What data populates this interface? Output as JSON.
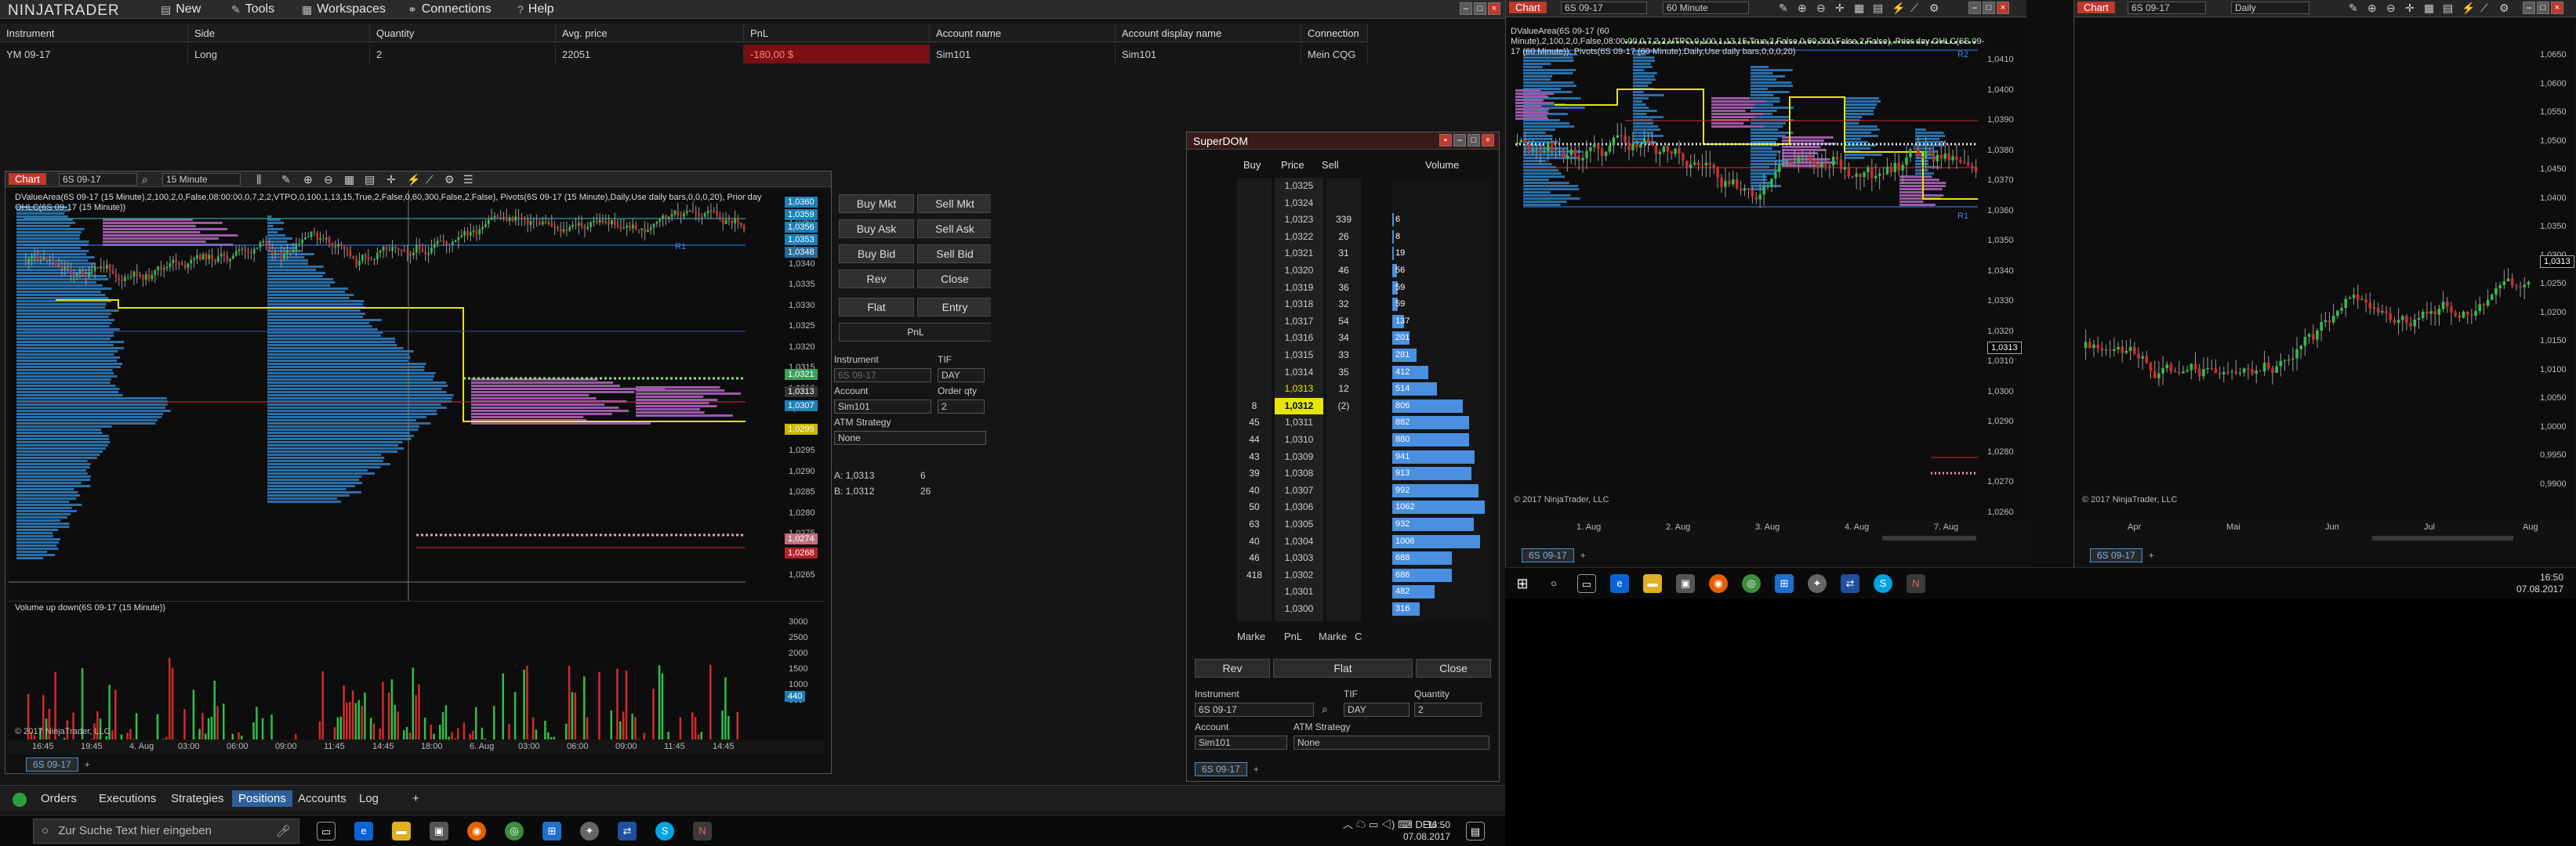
{
  "app": {
    "logo": "NINJATRADER"
  },
  "menu": [
    {
      "label": "New",
      "icon": "new-icon"
    },
    {
      "label": "Tools",
      "icon": "tools-icon"
    },
    {
      "label": "Workspaces",
      "icon": "workspaces-icon"
    },
    {
      "label": "Connections",
      "icon": "connections-icon"
    },
    {
      "label": "Help",
      "icon": "help-icon"
    }
  ],
  "positions": {
    "headers": [
      "Instrument",
      "Side",
      "Quantity",
      "Avg. price",
      "PnL",
      "Account name",
      "Account display name",
      "Connection"
    ],
    "row": [
      "YM 09-17",
      "Long",
      "2",
      "22051",
      "-180,00 $",
      "Sim101",
      "Sim101",
      "Mein CQG"
    ]
  },
  "chart1": {
    "title": "Chart",
    "instrument": "6S 09-17",
    "interval": "15 Minute",
    "description": "DValueArea(6S 09-17 (15 Minute),2,100,2,0,False,08:00:00,0,7,2,2,VTPO,0,100,1,13,15,True,2,False,0,60,300,False,2,False), Pivots(6S 09-17 (15 Minute),Daily,Use daily bars,0,0,0,20), Prior day OHLC(6S 09-17 (15 Minute))",
    "copyright": "© 2017 NinjaTrader, LLC",
    "subpanel": "Volume up down(6S 09-17 (15 Minute))",
    "pivot_label": "R1",
    "price_axis": [
      "1,0355",
      "1,0350",
      "1,0345",
      "1,0340",
      "1,0335",
      "1,0330",
      "1,0325",
      "1,0320",
      "1,0315",
      "1,0310",
      "1,0305",
      "1,0300",
      "1,0295",
      "1,0290",
      "1,0285",
      "1,0280",
      "1,0275",
      "1,0270",
      "1,0265"
    ],
    "vol_axis": [
      "3000",
      "2500",
      "2000",
      "1500",
      "1000",
      "500"
    ],
    "vol_tag": "440",
    "time_axis": [
      "16:45",
      "19:45",
      "4. Aug",
      "03:00",
      "06:00",
      "09:00",
      "11:45",
      "14:45",
      "18:00",
      "6. Aug",
      "03:00",
      "06:00",
      "09:00",
      "11:45",
      "14:45"
    ],
    "tags": [
      {
        "v": "1,0360",
        "c": "#1e7fb8"
      },
      {
        "v": "1,0359",
        "c": "#1e7fb8"
      },
      {
        "v": "1,0356",
        "c": "#1e7fb8"
      },
      {
        "v": "1,0353",
        "c": "#1e7fb8"
      },
      {
        "v": "1,0348",
        "c": "#2a6a9a"
      },
      {
        "v": "1,0321",
        "c": "#3aa05a"
      },
      {
        "v": "1,0313",
        "c": "#333333"
      },
      {
        "v": "1,0307",
        "c": "#1e7fb8"
      },
      {
        "v": "1,0295",
        "c": "#c9b800"
      },
      {
        "v": "1,0274",
        "c": "#c07080"
      },
      {
        "v": "1,0268",
        "c": "#b8202a"
      }
    ],
    "tab": "6S 09-17"
  },
  "chart_trader": {
    "buttons": [
      "Buy Mkt",
      "Sell Mkt",
      "Buy Ask",
      "Sell Ask",
      "Buy Bid",
      "Sell Bid",
      "Rev",
      "Close",
      "Flat",
      "Entry"
    ],
    "pnl_label": "PnL",
    "instrument_label": "Instrument",
    "instrument": "6S 09-17",
    "tif_label": "TIF",
    "tif": "DAY",
    "account_label": "Account",
    "account": "Sim101",
    "qty_label": "Order qty",
    "qty": "2",
    "atm_label": "ATM Strategy",
    "atm": "None",
    "ask": "A:  1,0313",
    "ask_size": "6",
    "bid": "B:  1,0312",
    "bid_size": "26"
  },
  "superdom": {
    "title": "SuperDOM",
    "headers": {
      "buy": "Buy",
      "price": "Price",
      "sell": "Sell",
      "volume": "Volume"
    },
    "rows": [
      {
        "p": "1,0325",
        "b": "",
        "s": "",
        "v": ""
      },
      {
        "p": "1,0324",
        "b": "",
        "s": "",
        "v": ""
      },
      {
        "p": "1,0323",
        "b": "",
        "s": "339",
        "v": "6"
      },
      {
        "p": "1,0322",
        "b": "",
        "s": "26",
        "v": "8"
      },
      {
        "p": "1,0321",
        "b": "",
        "s": "31",
        "v": "19"
      },
      {
        "p": "1,0320",
        "b": "",
        "s": "46",
        "v": "56"
      },
      {
        "p": "1,0319",
        "b": "",
        "s": "36",
        "v": "59"
      },
      {
        "p": "1,0318",
        "b": "",
        "s": "32",
        "v": "59"
      },
      {
        "p": "1,0317",
        "b": "",
        "s": "54",
        "v": "137"
      },
      {
        "p": "1,0316",
        "b": "",
        "s": "34",
        "v": "201"
      },
      {
        "p": "1,0315",
        "b": "",
        "s": "33",
        "v": "281"
      },
      {
        "p": "1,0314",
        "b": "",
        "s": "35",
        "v": "412"
      },
      {
        "p": "1,0313",
        "b": "",
        "s": "12",
        "v": "514"
      },
      {
        "p": "1,0312",
        "b": "8",
        "s": "(2)",
        "v": "806"
      },
      {
        "p": "1,0311",
        "b": "45",
        "s": "",
        "v": "882"
      },
      {
        "p": "1,0310",
        "b": "44",
        "s": "",
        "v": "880"
      },
      {
        "p": "1,0309",
        "b": "43",
        "s": "",
        "v": "941"
      },
      {
        "p": "1,0308",
        "b": "39",
        "s": "",
        "v": "913"
      },
      {
        "p": "1,0307",
        "b": "40",
        "s": "",
        "v": "992"
      },
      {
        "p": "1,0306",
        "b": "50",
        "s": "",
        "v": "1062"
      },
      {
        "p": "1,0305",
        "b": "63",
        "s": "",
        "v": "932"
      },
      {
        "p": "1,0304",
        "b": "40",
        "s": "",
        "v": "1006"
      },
      {
        "p": "1,0303",
        "b": "46",
        "s": "",
        "v": "688"
      },
      {
        "p": "1,0302",
        "b": "418",
        "s": "",
        "v": "686"
      },
      {
        "p": "1,0301",
        "b": "",
        "s": "",
        "v": "482"
      },
      {
        "p": "1,0300",
        "b": "",
        "s": "",
        "v": "316"
      }
    ],
    "market_left": "Marke",
    "pnl": "PnL",
    "market_right": "Marke",
    "c": "C",
    "rev": "Rev",
    "flat": "Flat",
    "close": "Close",
    "instrument_label": "Instrument",
    "instrument": "6S 09-17",
    "tif_label": "TIF",
    "tif": "DAY",
    "qty_label": "Quantity",
    "qty": "2",
    "account_label": "Account",
    "account": "Sim101",
    "atm_label": "ATM Strategy",
    "atm": "None",
    "tab": "6S 09-17"
  },
  "chart2": {
    "title": "Chart",
    "instrument": "6S 09-17",
    "interval": "60 Minute",
    "description": "DValueArea(6S 09-17 (60 Minute),2,100,2,0,False,08:00:00,0,7,2,2,VTPO,0,100,1,13,15,True,2,False,0,60,300,False,2,False), Prior day OHLC(6S 09-17 (60 Minute)), Pivots(6S 09-17 (60 Minute),Daily,Use daily bars,0,0,0,20)",
    "copyright": "© 2017 NinjaTrader, LLC",
    "labels": [
      "R2",
      "R1"
    ],
    "price_axis": [
      "1,0410",
      "1,0400",
      "1,0390",
      "1,0380",
      "1,0370",
      "1,0360",
      "1,0350",
      "1,0340",
      "1,0330",
      "1,0320",
      "1,0310",
      "1,0300",
      "1,0290",
      "1,0280",
      "1,0270",
      "1,0260"
    ],
    "last": "1,0313",
    "time_axis": [
      "1. Aug",
      "2. Aug",
      "3. Aug",
      "4. Aug",
      "7. Aug"
    ],
    "tab": "6S 09-17"
  },
  "chart3": {
    "title": "Chart",
    "instrument": "6S 09-17",
    "interval": "Daily",
    "copyright": "© 2017 NinjaTrader, LLC",
    "price_axis": [
      "1,0650",
      "1,0600",
      "1,0550",
      "1,0500",
      "1,0450",
      "1,0400",
      "1,0350",
      "1,0300",
      "1,0250",
      "1,0200",
      "1,0150",
      "1,0100",
      "1,0050",
      "1,0000",
      "0,9950",
      "0,9900"
    ],
    "last": "1,0313",
    "time_axis": [
      "Apr",
      "Mai",
      "Jun",
      "Jul",
      "Aug"
    ],
    "tab": "6S 09-17"
  },
  "bottom_tabs": [
    "Orders",
    "Executions",
    "Strategies",
    "Positions",
    "Accounts",
    "Log"
  ],
  "active_bottom_tab": "Positions",
  "taskbar_left": {
    "search": "Zur Suche Text hier eingeben",
    "time": "16:50",
    "date": "07.08.2017"
  },
  "taskbar_right": {
    "time": "16:50",
    "date": "07.08.2017"
  }
}
